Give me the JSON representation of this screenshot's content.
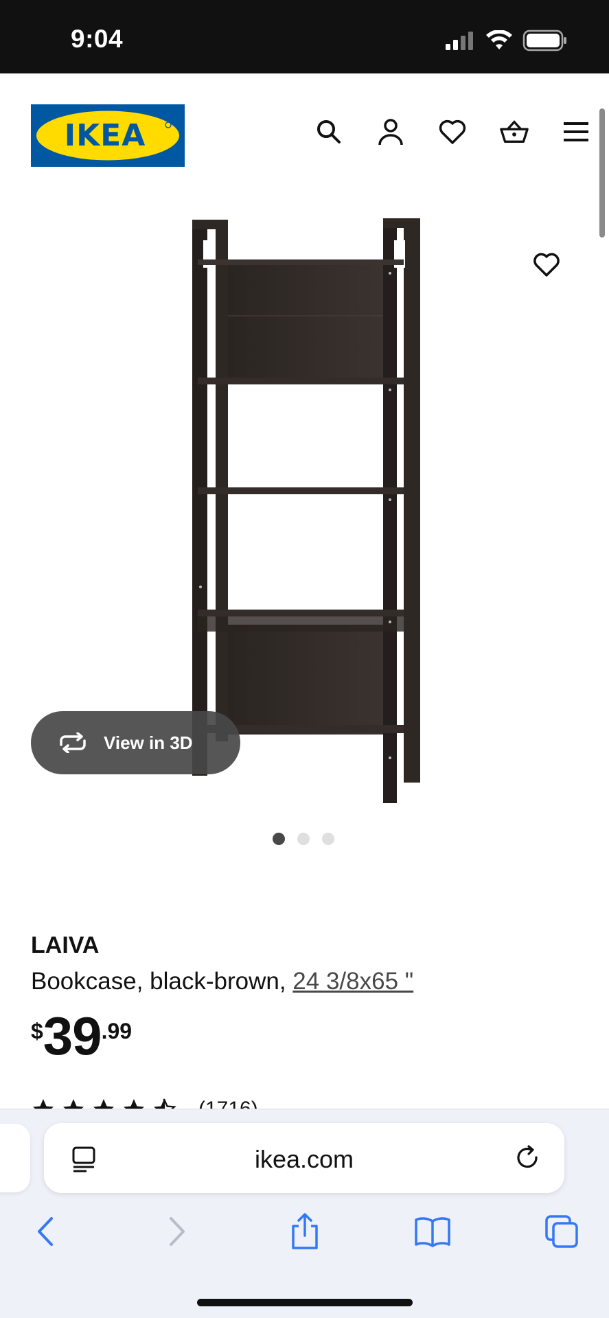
{
  "status_bar": {
    "time": "9:04"
  },
  "header": {
    "logo_text": "IKEA",
    "icons": [
      "search-icon",
      "account-icon",
      "favorites-icon",
      "basket-icon",
      "menu-icon"
    ]
  },
  "gallery": {
    "view_3d_label": "View in 3D",
    "page_count": 3,
    "active_page": 1
  },
  "product": {
    "name": "LAIVA",
    "description": "Bookcase, black-brown, ",
    "size_link": "24 3/8x65 \"",
    "price": {
      "currency": "$",
      "integer": "39",
      "decimal": ".99"
    },
    "rating": {
      "stars": 4.5,
      "review_count": "(1716)"
    }
  },
  "browser": {
    "url": "ikea.com",
    "toolbar": [
      "back-icon",
      "forward-icon",
      "share-icon",
      "bookmarks-icon",
      "tabs-icon"
    ]
  },
  "colors": {
    "ikea_blue": "#0058a3",
    "ikea_yellow": "#ffdb00",
    "safari_blue": "#3478f6",
    "shelf_brown": "#2b2522"
  }
}
